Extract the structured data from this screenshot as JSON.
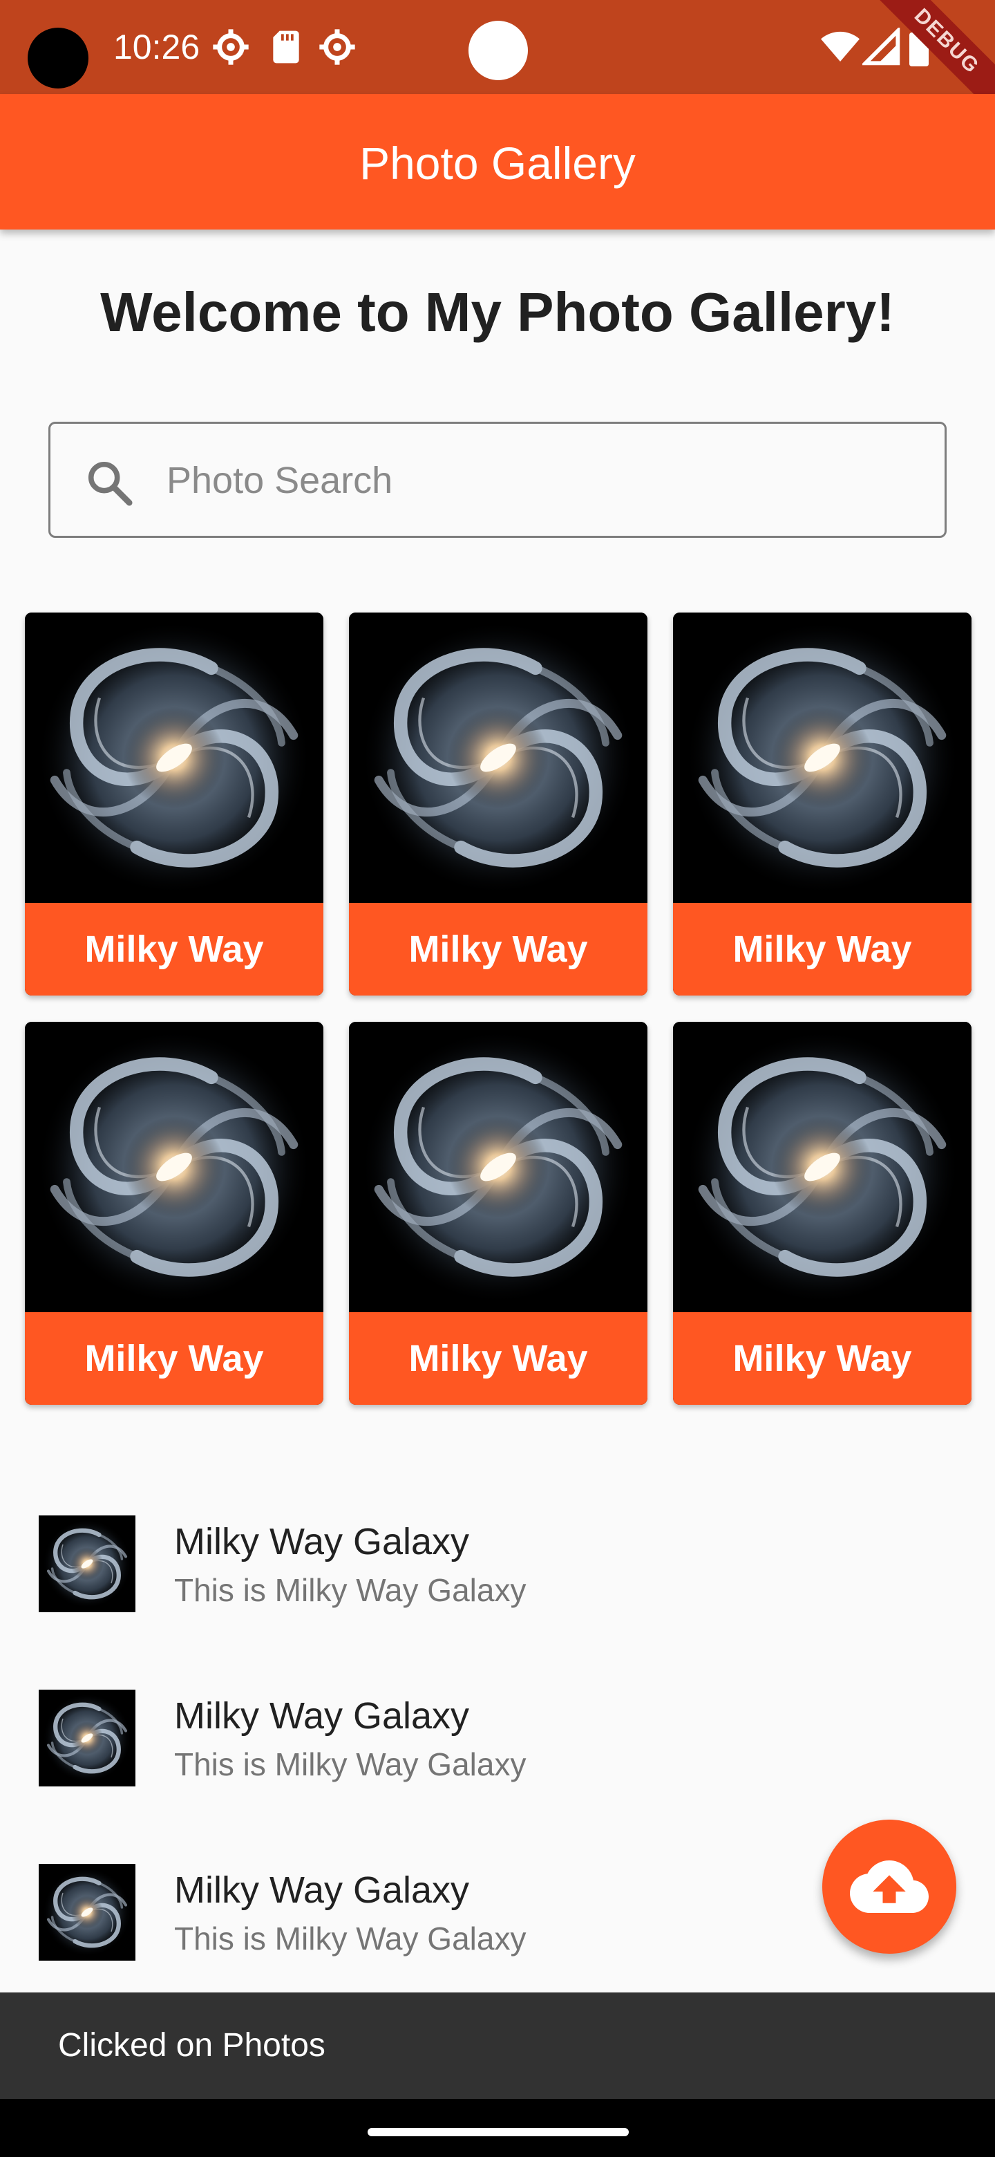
{
  "status_bar": {
    "time": "10:26",
    "icons": [
      "settings-gear-icon",
      "sd-card-icon",
      "settings-gear-icon",
      "wifi-icon",
      "signal-icon",
      "battery-icon"
    ],
    "debug_banner": "DEBUG"
  },
  "app_bar": {
    "title": "Photo Gallery"
  },
  "welcome_text": "Welcome to My Photo Gallery!",
  "search": {
    "placeholder": "Photo Search",
    "value": ""
  },
  "grid": {
    "items": [
      {
        "label": "Milky Way",
        "image": "milky-way-galaxy"
      },
      {
        "label": "Milky Way",
        "image": "milky-way-galaxy"
      },
      {
        "label": "Milky Way",
        "image": "milky-way-galaxy"
      },
      {
        "label": "Milky Way",
        "image": "milky-way-galaxy"
      },
      {
        "label": "Milky Way",
        "image": "milky-way-galaxy"
      },
      {
        "label": "Milky Way",
        "image": "milky-way-galaxy"
      }
    ]
  },
  "list": {
    "items": [
      {
        "title": "Milky Way Galaxy",
        "subtitle": "This is Milky Way Galaxy"
      },
      {
        "title": "Milky Way Galaxy",
        "subtitle": "This is Milky Way Galaxy"
      },
      {
        "title": "Milky Way Galaxy",
        "subtitle": "This is Milky Way Galaxy"
      }
    ]
  },
  "fab": {
    "icon": "cloud-upload-icon"
  },
  "snackbar": {
    "message": "Clicked on Photos"
  },
  "colors": {
    "status_bar": "#bf441d",
    "accent": "#ff5722",
    "snackbar": "#323232",
    "background": "#fafafa"
  }
}
